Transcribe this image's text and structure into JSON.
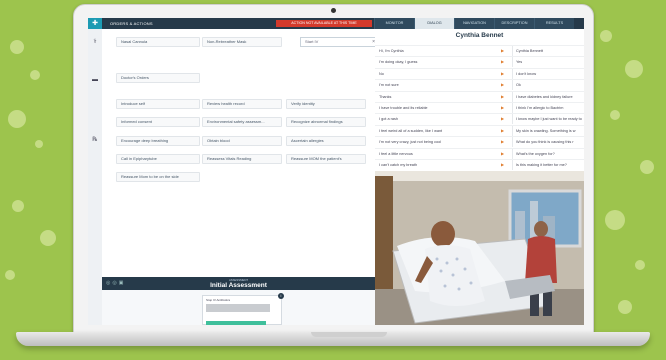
{
  "topbar": {
    "section_title": "ORDERS & ACTIONS",
    "warning": "ACTION NOT AVAILABLE AT THIS TIME",
    "tabs": [
      "MONITOR",
      "DIALOG",
      "NAVIGATION",
      "DESCRIPTION",
      "RESULTS"
    ],
    "active_tab": "DIALOG"
  },
  "search": {
    "value": "Start IV"
  },
  "actions": {
    "row1": [
      "Nasal Cannula",
      "Non-Rebreather Mask"
    ],
    "row2": [
      "Doctor's Orders"
    ],
    "row3": [
      "Introduce self",
      "Review health record",
      "Verify identity"
    ],
    "row4": [
      "Informed consent",
      "Environmental safety assessm...",
      "Recognize abnormal findings"
    ],
    "row5": [
      "Encourage deep breathing",
      "Obtain blood",
      "Ascertain allergies"
    ],
    "row6": [
      "Call in Epipharytube",
      "Reassess Vitals Reading",
      "Reassure MOM the patient's"
    ],
    "row7": [
      "Reassure Mom to be on the side"
    ]
  },
  "assessment": {
    "subtitle": "ASSESSMENT",
    "title": "Initial Assessment",
    "card_label": "Stop IV Antibiotics",
    "badge": "i"
  },
  "dialog": {
    "patient_name": "Cynthia Bennet",
    "rows": [
      {
        "q": "Hi, I'm Cynthia",
        "a": "Cynthia Bennett"
      },
      {
        "q": "I'm doing okay, I guess",
        "a": "Yes"
      },
      {
        "q": "No",
        "a": "I don't know"
      },
      {
        "q": "I'm not sure",
        "a": "Ok"
      },
      {
        "q": "Thanks",
        "a": "I have diabetes and kidney failure"
      },
      {
        "q": "I have trouble and its reliable",
        "a": "I think I'm allergic to Bactrim"
      },
      {
        "q": "I got a rash",
        "a": "I know maybe I just want to be ready to"
      },
      {
        "q": "I feel weird all of a sudden, like I want",
        "a": "My skin is crawling. Something is w"
      },
      {
        "q": "I'm not very crazy, just not being cool",
        "a": "What do you think is causing this r"
      },
      {
        "q": "I feel a little nervous",
        "a": "What's the oxygen for?"
      },
      {
        "q": "I can't catch my breath",
        "a": "Is this making it better for me?"
      }
    ]
  },
  "icons": {
    "logo": "stethoscope-logo-icon",
    "side": [
      "stethoscope-icon",
      "clipboard-icon",
      "pill-icon"
    ],
    "arrow": "chevron-right-icon",
    "close": "close-icon"
  },
  "colors": {
    "background": "#9dc44d",
    "topbar": "#263a4a",
    "warning": "#d33a2c",
    "accent": "#1d9bb3",
    "arrow": "#e07d2e"
  }
}
